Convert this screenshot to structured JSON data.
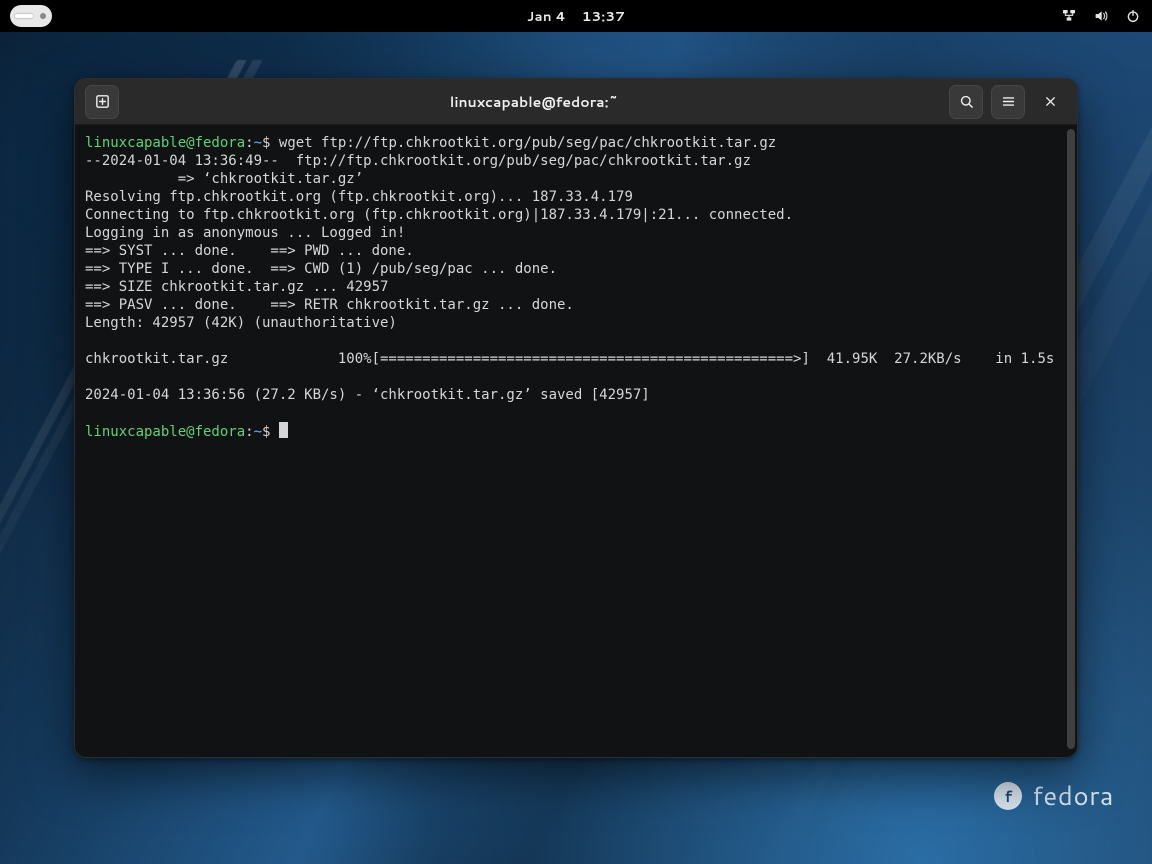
{
  "topbar": {
    "date": "Jan 4",
    "time": "13:37",
    "network_icon": "network-wired",
    "volume_icon": "volume",
    "power_icon": "power",
    "activities": "Activities"
  },
  "window": {
    "title": "linuxcapable@fedora:~",
    "newtab_label": "New Tab",
    "search_label": "Search",
    "menu_label": "Menu",
    "close_label": "Close"
  },
  "prompt": {
    "userhost": "linuxcapable@fedora",
    "sep": ":",
    "path": "~",
    "symbol": "$"
  },
  "commands": {
    "cmd1": "wget ftp://ftp.chkrootkit.org/pub/seg/pac/chkrootkit.tar.gz"
  },
  "output": {
    "l01": "--2024-01-04 13:36:49--  ftp://ftp.chkrootkit.org/pub/seg/pac/chkrootkit.tar.gz",
    "l02": "           => ‘chkrootkit.tar.gz’",
    "l03": "Resolving ftp.chkrootkit.org (ftp.chkrootkit.org)... 187.33.4.179",
    "l04": "Connecting to ftp.chkrootkit.org (ftp.chkrootkit.org)|187.33.4.179|:21... connected.",
    "l05": "Logging in as anonymous ... Logged in!",
    "l06": "==> SYST ... done.    ==> PWD ... done.",
    "l07": "==> TYPE I ... done.  ==> CWD (1) /pub/seg/pac ... done.",
    "l08": "==> SIZE chkrootkit.tar.gz ... 42957",
    "l09": "==> PASV ... done.    ==> RETR chkrootkit.tar.gz ... done.",
    "l10": "Length: 42957 (42K) (unauthoritative)",
    "l11": "",
    "l12": "chkrootkit.tar.gz             100%[=================================================>]  41.95K  27.2KB/s    in 1.5s",
    "l13": "",
    "l14": "2024-01-04 13:36:56 (27.2 KB/s) - ‘chkrootkit.tar.gz’ saved [42957]",
    "l15": ""
  },
  "watermark": {
    "text": "fedora",
    "glyph": "f"
  }
}
